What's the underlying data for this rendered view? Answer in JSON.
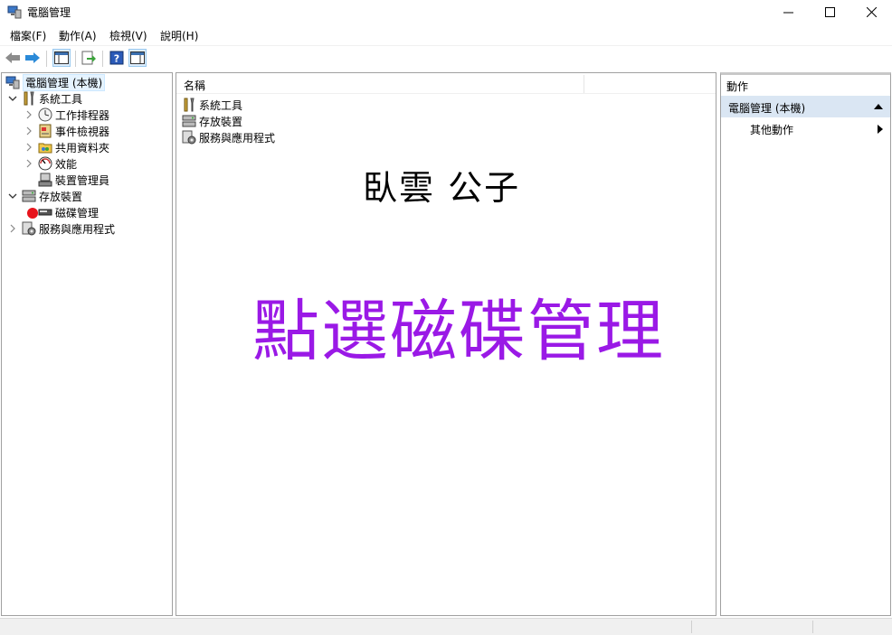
{
  "window": {
    "title": "電腦管理"
  },
  "menu": {
    "items": [
      "檔案(F)",
      "動作(A)",
      "檢視(V)",
      "說明(H)"
    ]
  },
  "tree": {
    "root": "電腦管理 (本機)",
    "system_tools": "系統工具",
    "task_scheduler": "工作排程器",
    "event_viewer": "事件檢視器",
    "shared_folders": "共用資料夾",
    "performance": "效能",
    "device_manager": "裝置管理員",
    "storage": "存放裝置",
    "disk_management": "磁碟管理",
    "services_apps": "服務與應用程式"
  },
  "center": {
    "column_header": "名稱",
    "items": [
      "系統工具",
      "存放裝置",
      "服務與應用程式"
    ],
    "watermark": "臥雲 公子",
    "annotation": "點選磁碟管理"
  },
  "actions": {
    "header": "動作",
    "section": "電腦管理 (本機)",
    "more": "其他動作"
  },
  "colors": {
    "annotation": "#9a19e6",
    "marker": "#e8141c",
    "selection": "#e5f3ff"
  }
}
